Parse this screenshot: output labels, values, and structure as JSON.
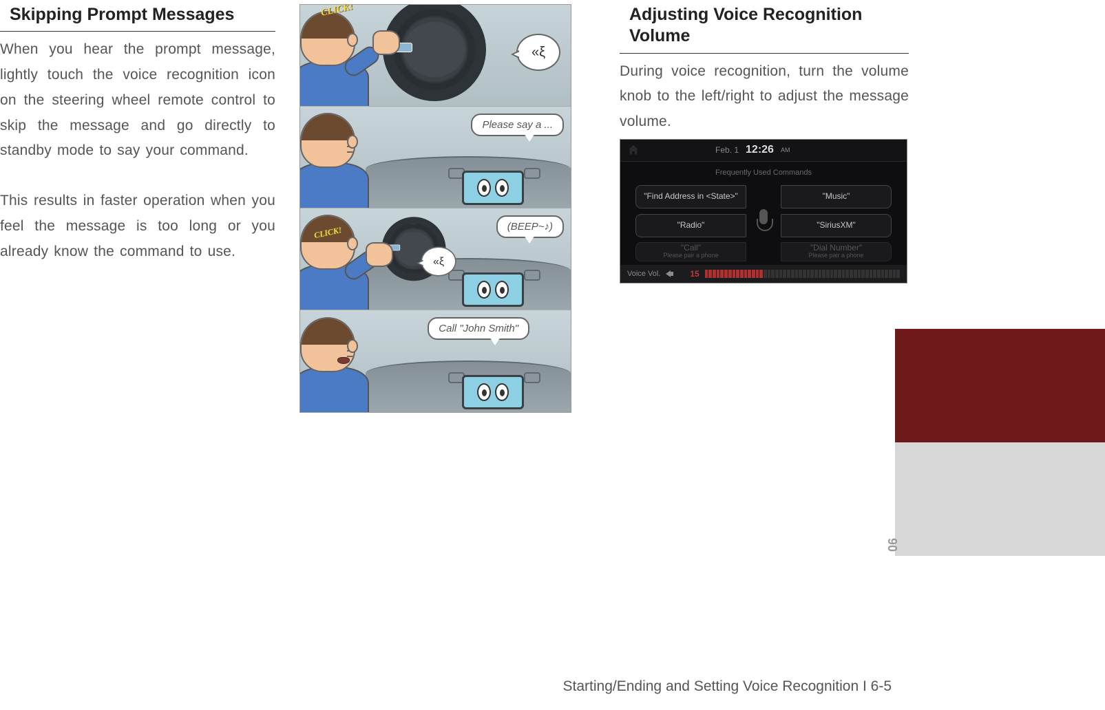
{
  "left": {
    "heading": "Skipping Prompt Messages",
    "p1": "When you hear the prompt message, lightly touch the voice recognition icon on the steering wheel remote control to skip the message and go directly to standby mode to say your command.",
    "p2": "This results in faster operation when you feel the message is too long or you already know the command to use."
  },
  "comic": {
    "click_label": "CLICK!",
    "speech_prompt": "Please say a ...",
    "speech_beep": "(BEEP~♪)",
    "speech_call": "Call \"John Smith\""
  },
  "right": {
    "heading": "Adjusting Voice Recognition Volume",
    "p1": "During voice recognition, turn the volume knob to the left/right to adjust the message volume."
  },
  "screenshot": {
    "date": "Feb.  1",
    "time": "12:26",
    "ampm": "AM",
    "section_label": "Frequently Used Commands",
    "cmd_find_address": "\"Find Address in <State>\"",
    "cmd_music": "\"Music\"",
    "cmd_radio": "\"Radio\"",
    "cmd_siriusxm": "\"SiriusXM\"",
    "cmd_call": "\"Call\"",
    "cmd_dial": "\"Dial Number\"",
    "pair_hint": "Please pair a phone",
    "vol_label": "Voice Vol.",
    "vol_value": "15"
  },
  "tab_number": "06",
  "footer": "Starting/Ending and Setting Voice Recognition I 6-5"
}
